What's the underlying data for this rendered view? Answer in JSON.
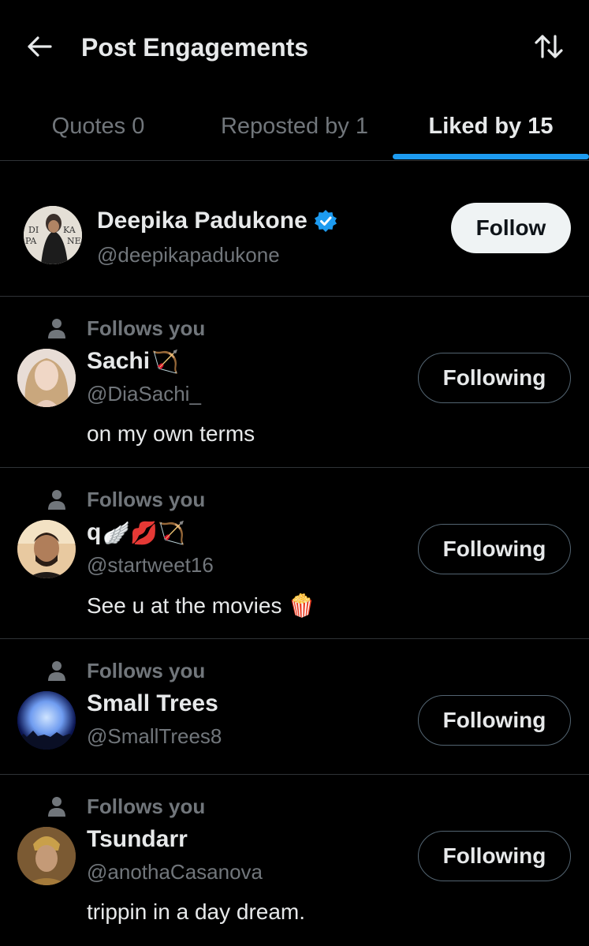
{
  "header": {
    "title": "Post Engagements",
    "back_icon": "arrow-left-icon",
    "sort_icon": "sort-arrows-icon"
  },
  "tabs": [
    {
      "label": "Quotes 0",
      "active": false
    },
    {
      "label": "Reposted by 1",
      "active": false
    },
    {
      "label": "Liked by 15",
      "active": true
    }
  ],
  "colors": {
    "accent": "#1d9bf0",
    "verified": "#1d9bf0",
    "background": "#000000",
    "muted": "#71767b"
  },
  "users": [
    {
      "name": "Deepika Padukone",
      "handle": "@deepikapadukone",
      "verified": true,
      "follows_you": false,
      "button": "Follow",
      "bio": ""
    },
    {
      "name": "Sachi",
      "name_emoji": "🏹",
      "handle": "@DiaSachi_",
      "follows_you": true,
      "follows_you_label": "Follows you",
      "button": "Following",
      "bio": "on my own terms"
    },
    {
      "name": "q",
      "name_emoji": "🪽💋🏹",
      "handle": "@startweet16",
      "follows_you": true,
      "follows_you_label": "Follows you",
      "button": "Following",
      "bio": "See u at the movies 🍿"
    },
    {
      "name": "Small Trees",
      "handle": "@SmallTrees8",
      "follows_you": true,
      "follows_you_label": "Follows you",
      "button": "Following",
      "bio": ""
    },
    {
      "name": "Tsundarr",
      "handle": "@anothaCasanova",
      "follows_you": true,
      "follows_you_label": "Follows you",
      "button": "Following",
      "bio": "trippin in a day dream."
    }
  ]
}
